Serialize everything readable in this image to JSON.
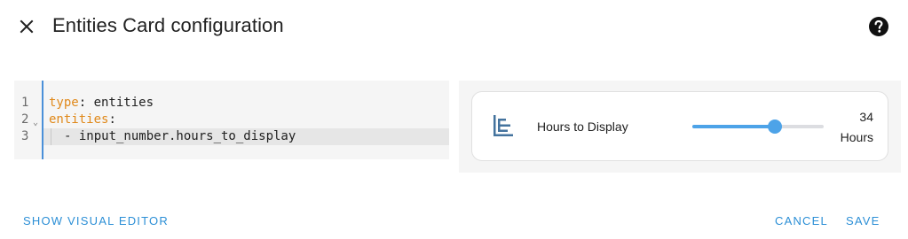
{
  "dialog": {
    "title": "Entities Card configuration",
    "close_icon": "close-icon",
    "help_icon": "help-circle-icon"
  },
  "editor": {
    "lines": [
      {
        "number": "1",
        "key": "type",
        "rest": ": entities"
      },
      {
        "number": "2",
        "key": "entities",
        "rest": ":"
      },
      {
        "number": "3",
        "dash": "- ",
        "value": "input_number.hours_to_display"
      }
    ],
    "fold_marker": "⌄"
  },
  "preview": {
    "entity_icon": "chart-timeline-icon",
    "entity_name": "Hours to Display",
    "slider_fraction": 0.63,
    "value": "34",
    "unit": "Hours"
  },
  "footer": {
    "show_visual_editor": "SHOW VISUAL EDITOR",
    "cancel": "CANCEL",
    "save": "SAVE"
  },
  "colors": {
    "accent": "#2c8fd6",
    "slider": "#4da3e8",
    "yaml_key": "#e0891b"
  }
}
